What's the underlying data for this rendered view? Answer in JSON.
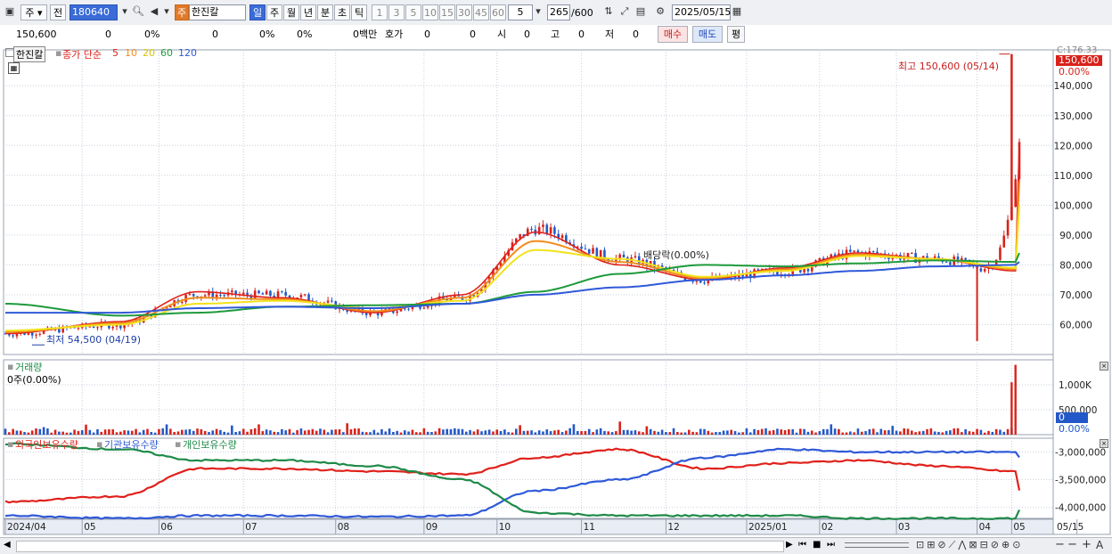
{
  "toolbar": {
    "type_label": "주",
    "prev_label": "전",
    "code": "180640",
    "stock_badge": "주",
    "stock_name": "한진칼",
    "periods": [
      "일",
      "주",
      "월",
      "년",
      "분",
      "초",
      "틱"
    ],
    "selected_period": "일",
    "intervals": [
      "1",
      "3",
      "5",
      "10",
      "15",
      "30",
      "45",
      "60"
    ],
    "interval_value": "5",
    "bar_count": "265",
    "bar_total": "/600",
    "date": "2025/05/15"
  },
  "quote": {
    "price": "150,600",
    "change": "0",
    "change_pct": "0%",
    "volume": "0",
    "vol_pct": "0%",
    "turnover_pct": "0%",
    "amount": "0백만",
    "hoga_label": "호가",
    "hoga_value": "0",
    "hoga_value2": "0",
    "open_label": "시",
    "open_value": "0",
    "high_label": "고",
    "high_value": "0",
    "low_label": "저",
    "low_value": "0",
    "buy_label": "매수",
    "sell_label": "매도",
    "avg_label": "평"
  },
  "colors": {
    "ma5": "#e0211b",
    "ma10": "#f08c1e",
    "ma20": "#f2e21a",
    "ma60": "#1e9a3c",
    "ma120": "#2f59d8",
    "up": "#d8221a",
    "down": "#2358c8",
    "foreign": "#e0211b",
    "institution": "#2f59d8",
    "individual": "#1e8a48"
  },
  "price_panel": {
    "stock_tag": "한진칼",
    "ma_label": "종가 단순",
    "ma_periods": [
      "5",
      "10",
      "20",
      "60",
      "120"
    ],
    "high_annotation": "최고 150,600 (05/14)",
    "low_annotation": "최저 54,500 (04/19)",
    "dividend_annotation": "배당락(0.00%)",
    "current_tag": "150,600",
    "top_tag": "C:176.33",
    "pct_tag": "0.00%"
  },
  "volume_panel": {
    "title": "거래량",
    "value_label": "0주(0.00%)",
    "current_tag": "0",
    "pct_tag": "0.00%"
  },
  "holdings_panel": {
    "series_names": [
      "외국인보유수량",
      "기관보유수량",
      "개인보유수량"
    ]
  },
  "bottom": {
    "icons": [
      "play-icon",
      "rewind-icon",
      "stop-icon",
      "fast-forward-icon"
    ]
  },
  "chart_data": [
    {
      "type": "line",
      "title": "",
      "subtype": "candlestick-with-moving-averages",
      "x_tick_labels": [
        "2024/04",
        "05",
        "06",
        "07",
        "08",
        "09",
        "10",
        "11",
        "12",
        "2025/01",
        "02",
        "03",
        "04",
        "05",
        "05/15"
      ],
      "y_tick_labels": [
        "60,000",
        "70,000",
        "80,000",
        "90,000",
        "100,000",
        "110,000",
        "120,000",
        "130,000",
        "140,000"
      ],
      "ylim": [
        50000,
        152000
      ],
      "close_approx_by_month": {
        "categories": [
          "2024/04",
          "05",
          "06",
          "07",
          "08",
          "09",
          "10",
          "11",
          "12",
          "2025/01",
          "02",
          "03",
          "04",
          "05"
        ],
        "close": [
          57000,
          60000,
          70000,
          70000,
          64000,
          69000,
          92000,
          82000,
          75000,
          78000,
          84000,
          82000,
          77000,
          120000
        ]
      },
      "series": [
        {
          "name": "5",
          "values": [
            57000,
            61000,
            71000,
            69000,
            64000,
            70000,
            91000,
            80000,
            75000,
            79000,
            84000,
            82000,
            78000,
            120000
          ]
        },
        {
          "name": "10",
          "values": [
            57500,
            60500,
            69000,
            68500,
            64500,
            69000,
            88000,
            81000,
            75500,
            78500,
            83500,
            82000,
            78500,
            108000
          ]
        },
        {
          "name": "20",
          "values": [
            58000,
            60000,
            67000,
            68000,
            65500,
            68000,
            85000,
            82000,
            76000,
            78000,
            83000,
            82000,
            79000,
            100000
          ]
        },
        {
          "name": "60",
          "values": [
            67000,
            63000,
            64000,
            66000,
            66500,
            67000,
            71000,
            77000,
            80000,
            79500,
            80500,
            81500,
            81000,
            84000
          ]
        },
        {
          "name": "120",
          "values": [
            64000,
            64000,
            65500,
            66000,
            65500,
            67000,
            70000,
            72500,
            75000,
            76500,
            78000,
            79500,
            80000,
            81000
          ]
        }
      ],
      "high": {
        "value": 150600,
        "date": "05/14"
      },
      "low": {
        "value": 54500,
        "date": "04/19"
      }
    },
    {
      "type": "bar",
      "title": "",
      "y_tick_labels": [
        "1,000K",
        "500,000"
      ],
      "ylim": [
        0,
        1500000
      ],
      "last_bars": [
        {
          "date": "05/13",
          "value": 1050000
        },
        {
          "date": "05/14",
          "value": 1400000
        }
      ]
    },
    {
      "type": "line",
      "title": "",
      "y_tick_labels": [
        "-3,000,000",
        "-3,500,000",
        "-4,000,000"
      ],
      "ylim": [
        -4200000,
        -2750000
      ],
      "categories": [
        "2024/04",
        "05",
        "06",
        "07",
        "08",
        "09",
        "10",
        "11",
        "12",
        "2025/01",
        "02",
        "03",
        "04",
        "05"
      ],
      "series": [
        {
          "name": "외국인보유수량",
          "values": [
            -3900000,
            -3800000,
            -3300000,
            -3300000,
            -3350000,
            -3400000,
            -3100000,
            -2950000,
            -3300000,
            -3200000,
            -3150000,
            -3250000,
            -3350000,
            -3700000
          ]
        },
        {
          "name": "기관보유수량",
          "values": [
            -4150000,
            -4200000,
            -4150000,
            -4150000,
            -4170000,
            -4150000,
            -3700000,
            -3500000,
            -3100000,
            -2950000,
            -3000000,
            -3000000,
            -3000000,
            -3100000
          ]
        },
        {
          "name": "개인보유수량",
          "values": [
            -2850000,
            -2950000,
            -3150000,
            -3150000,
            -3250000,
            -3500000,
            -4100000,
            -4150000,
            -4150000,
            -4150000,
            -4200000,
            -4200000,
            -4200000,
            -4050000
          ]
        }
      ]
    }
  ]
}
